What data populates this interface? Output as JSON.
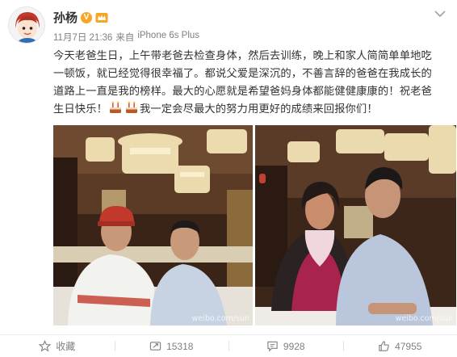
{
  "post": {
    "author": "孙杨",
    "time": "11月7日 21:36",
    "source_prefix": "来自",
    "source": "iPhone 6s Plus",
    "text_lines": [
      "今天老爸生日，上午带老爸去检查身体，然后去训练，晚上和家人简简单单地吃",
      "一顿饭，就已经觉得很幸福了。都说父爱是深沉的，不善言辞的爸爸在我成长的",
      "道路上一直是我的榜样。最大的心愿就是希望爸妈身体都能健健康康的！祝老爸",
      "我一定会尽最大的努力用更好的成绩来回报你们！"
    ],
    "line4_prefix": "生日快乐！",
    "emojis": [
      "cake-icon",
      "cake-icon"
    ],
    "watermark_left": "weibo.com/sun",
    "watermark_right": "weibo.com/sun"
  },
  "actions": {
    "favorite_label": "收藏",
    "repost_count": "15318",
    "comment_count": "9928",
    "like_count": "47955"
  },
  "colors": {
    "text": "#333333",
    "meta": "#808080",
    "badge": "#f6a623"
  }
}
